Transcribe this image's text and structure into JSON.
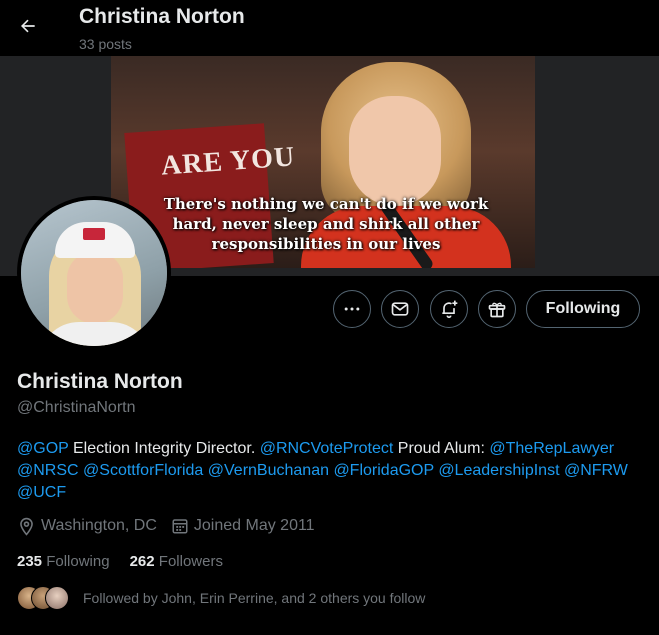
{
  "header": {
    "name": "Christina Norton",
    "posts": "33 posts"
  },
  "banner": {
    "sign_text": "ARE YOU",
    "caption_line1": "There's nothing we can't do if we work",
    "caption_line2": "hard, never sleep and shirk all other",
    "caption_line3": "responsibilities in our lives"
  },
  "actions": {
    "following_label": "Following"
  },
  "profile": {
    "name": "Christina Norton",
    "handle": "@ChristinaNortn"
  },
  "bio": {
    "m1": "@GOP",
    "t1": " Election Integrity Director. ",
    "m2": "@RNCVoteProtect",
    "t2": " Proud Alum: ",
    "m3": "@TheRepLawyer",
    "m4": "@NRSC",
    "m5": "@ScottforFlorida",
    "m6": "@VernBuchanan",
    "m7": "@FloridaGOP",
    "m8": "@LeadershipInst",
    "m9": "@NFRW",
    "m10": "@UCF"
  },
  "meta": {
    "location": "Washington, DC",
    "joined": "Joined May 2011"
  },
  "stats": {
    "following_count": "235",
    "following_label": "Following",
    "followers_count": "262",
    "followers_label": "Followers"
  },
  "followed_by": "Followed by John, Erin Perrine, and 2 others you follow",
  "colors": {
    "accent": "#1d9bf0",
    "muted": "#71767b",
    "text": "#e7e9ea",
    "border": "#536471"
  }
}
